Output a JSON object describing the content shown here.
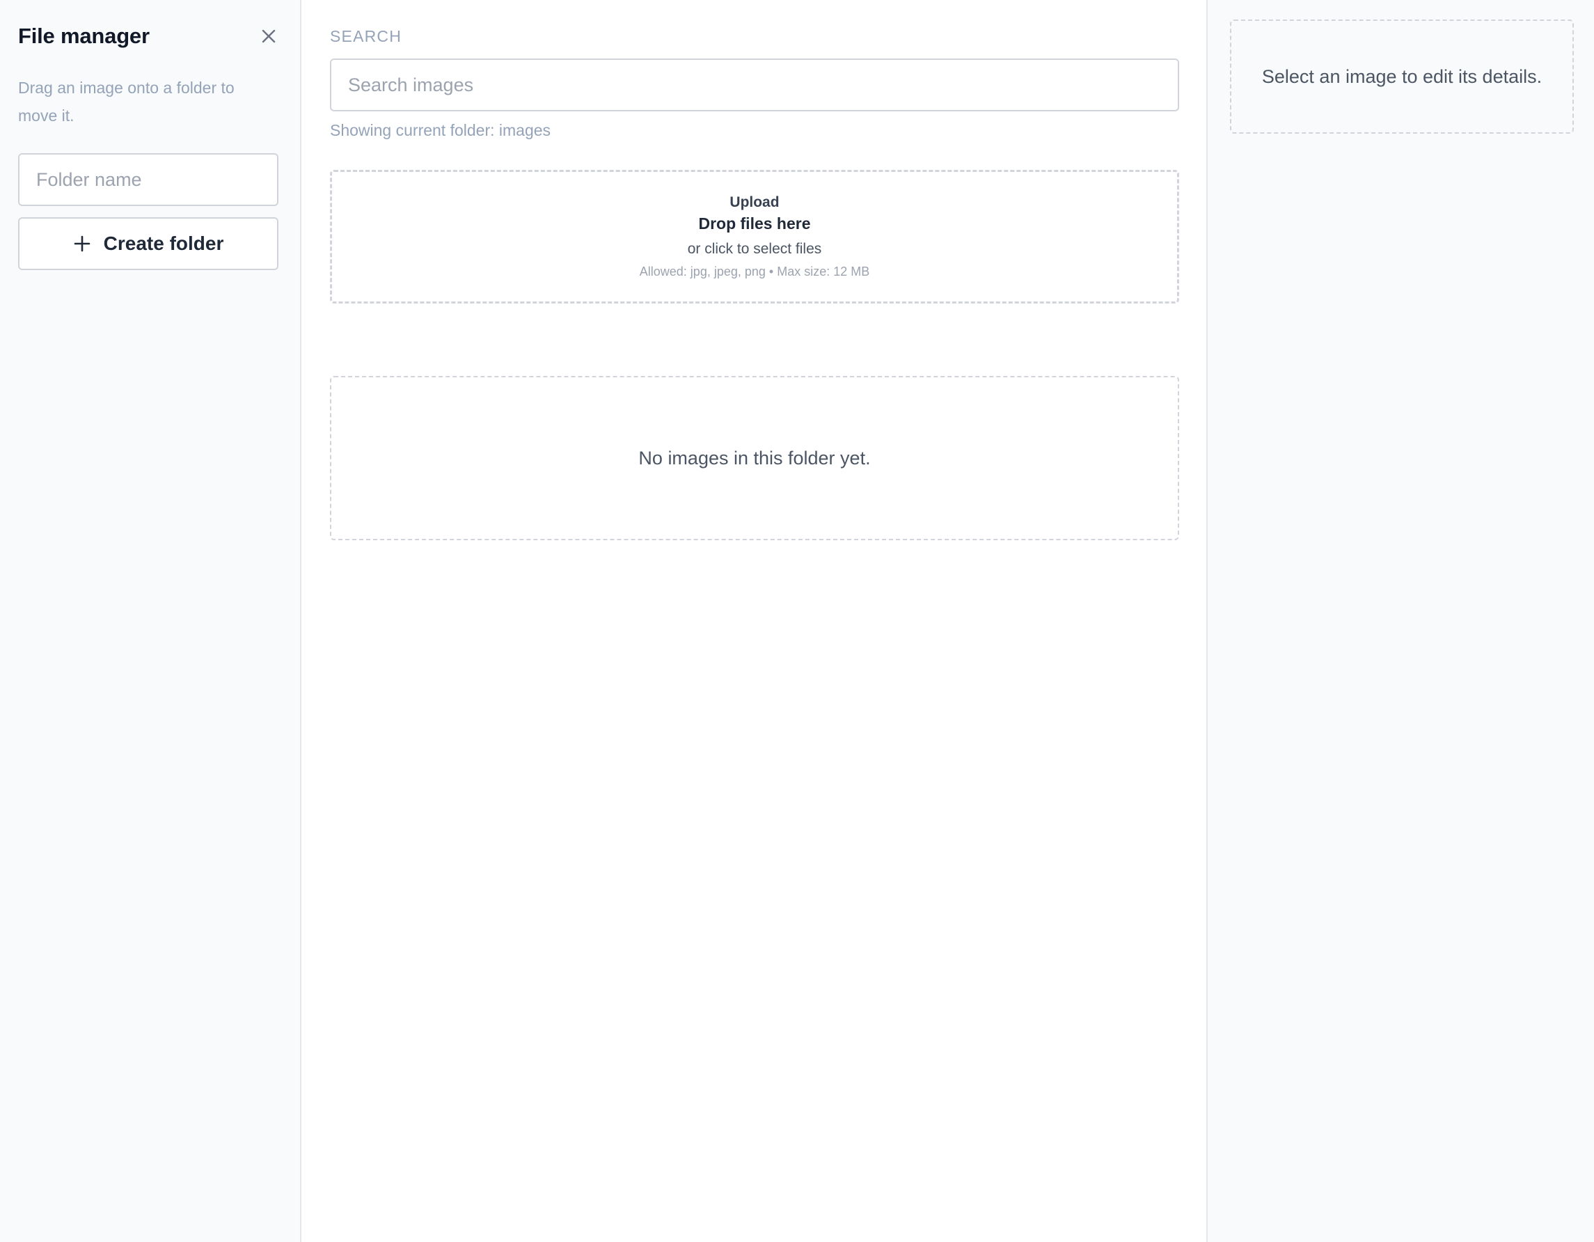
{
  "sidebar": {
    "title": "File manager",
    "close_icon": "close-icon",
    "hint": "Drag an image onto a folder to move it.",
    "folder_name_placeholder": "Folder name",
    "create_folder_label": "Create folder",
    "create_folder_icon": "plus-icon"
  },
  "main": {
    "search_label": "SEARCH",
    "search_placeholder": "Search images",
    "folder_status": "Showing current folder: images",
    "upload": {
      "label": "Upload",
      "title": "Drop files here",
      "subtitle": "or click to select files",
      "meta": "Allowed: jpg, jpeg, png • Max size: 12 MB"
    },
    "empty_message": "No images in this folder yet."
  },
  "details": {
    "placeholder": "Select an image to edit its details."
  },
  "colors": {
    "sidebar_bg": "#f8fafc",
    "border": "#d1d5db",
    "muted_text": "#94a3b8",
    "heading_text": "#111827"
  }
}
